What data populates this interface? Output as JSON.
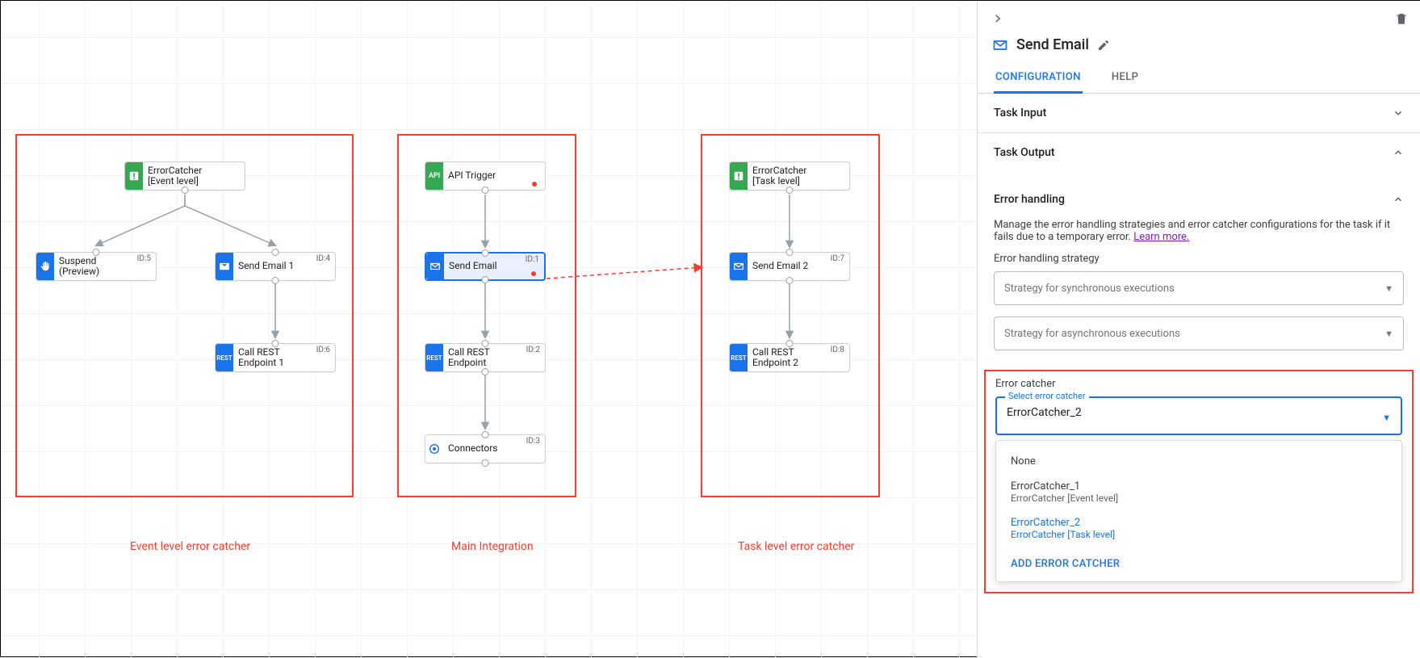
{
  "canvas": {
    "zones": {
      "event": {
        "label": "Event level error catcher"
      },
      "main": {
        "label": "Main Integration"
      },
      "task": {
        "label": "Task level error catcher"
      }
    },
    "nodes": {
      "ec_event": {
        "line1": "ErrorCatcher",
        "line2": "[Event level]"
      },
      "suspend": {
        "line1": "Suspend",
        "line2": "(Preview)",
        "id": "ID:5"
      },
      "email1": {
        "line1": "Send Email 1",
        "id": "ID:4"
      },
      "rest1": {
        "line1": "Call REST",
        "line2": "Endpoint 1",
        "id": "ID:6"
      },
      "api": {
        "line1": "API Trigger"
      },
      "email": {
        "line1": "Send Email",
        "id": "ID:1"
      },
      "rest": {
        "line1": "Call REST",
        "line2": "Endpoint",
        "id": "ID:2"
      },
      "connectors": {
        "line1": "Connectors",
        "id": "ID:3"
      },
      "ec_task": {
        "line1": "ErrorCatcher",
        "line2": "[Task level]"
      },
      "email2": {
        "line1": "Send Email 2",
        "id": "ID:7"
      },
      "rest2": {
        "line1": "Call REST",
        "line2": "Endpoint 2",
        "id": "ID:8"
      }
    }
  },
  "panel": {
    "title": "Send Email",
    "tabs": {
      "config": "CONFIGURATION",
      "help": "HELP"
    },
    "sections": {
      "input": "Task Input",
      "output": "Task Output",
      "error": "Error handling"
    },
    "error_desc": "Manage the error handling strategies and error catcher configurations for the task if it fails due to a temporary error.",
    "learn_more": "Learn more.",
    "strategy_label": "Error handling strategy",
    "sync": "Strategy for synchronous executions",
    "async": "Strategy for asynchronous executions",
    "catcher_label": "Error catcher",
    "select_label": "Select error catcher",
    "select_value": "ErrorCatcher_2",
    "dd": {
      "none": "None",
      "opt1": "ErrorCatcher_1",
      "opt1sub": "ErrorCatcher [Event level]",
      "opt2": "ErrorCatcher_2",
      "opt2sub": "ErrorCatcher [Task level]",
      "add": "ADD ERROR CATCHER"
    }
  }
}
